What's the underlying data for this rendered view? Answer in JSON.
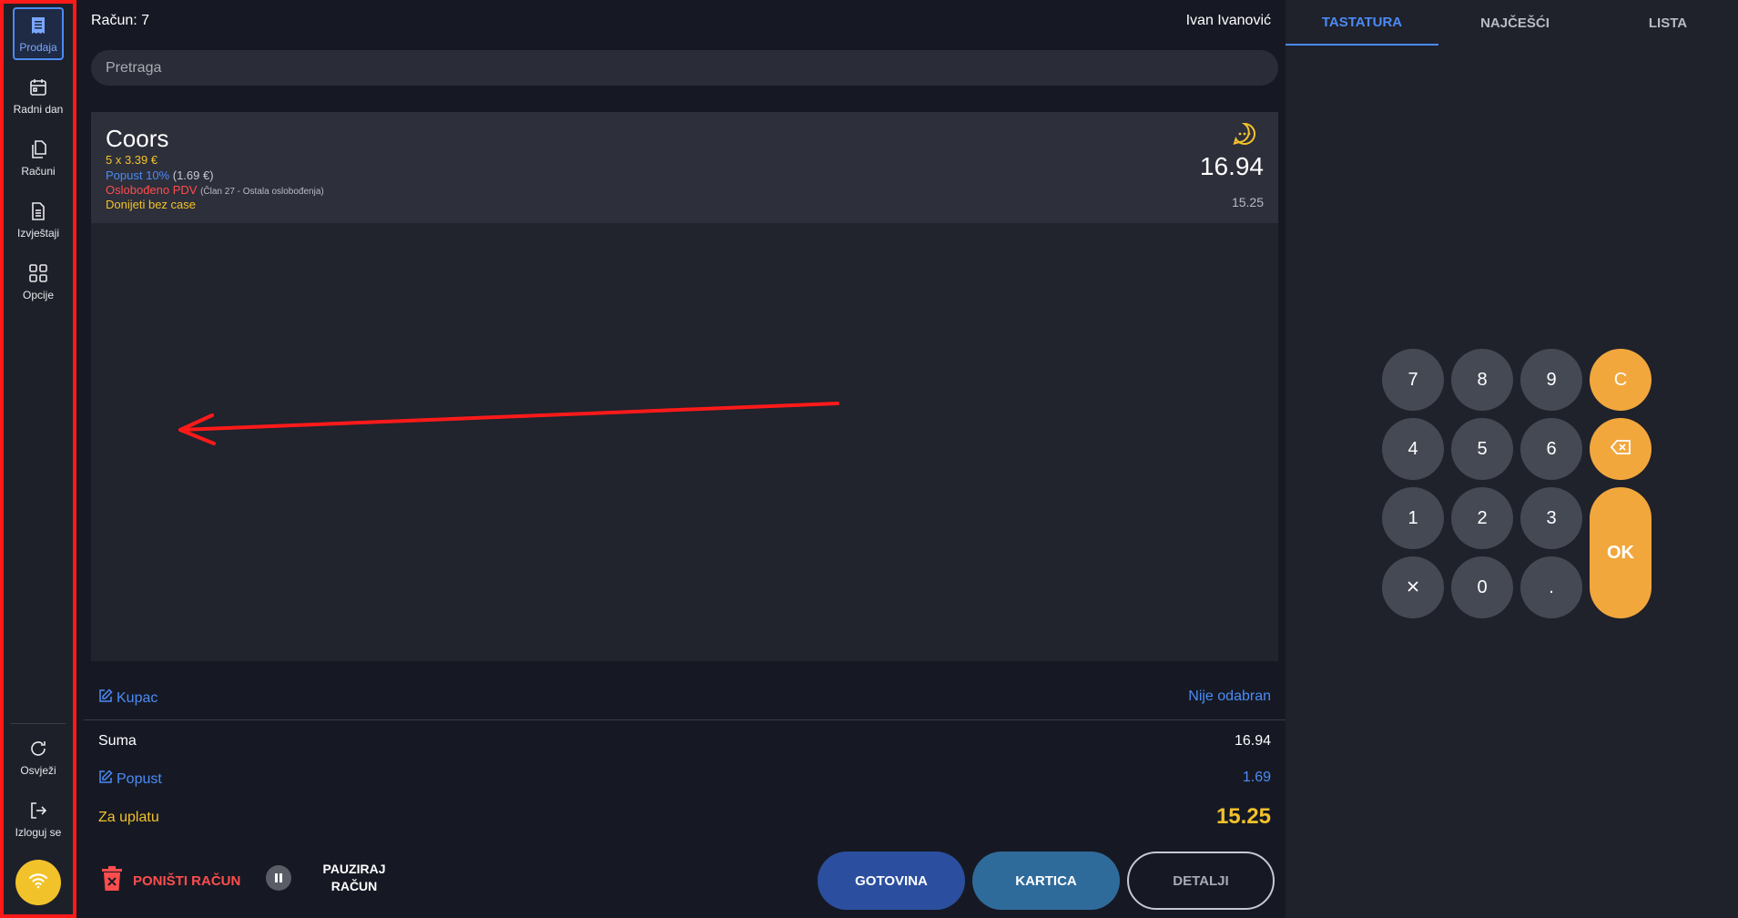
{
  "sidebar": {
    "items": [
      {
        "label": "Prodaja"
      },
      {
        "label": "Radni dan"
      },
      {
        "label": "Računi"
      },
      {
        "label": "Izvještaji"
      },
      {
        "label": "Opcije"
      }
    ],
    "bottom": [
      {
        "label": "Osvježi"
      },
      {
        "label": "Izloguj se"
      }
    ]
  },
  "header": {
    "racun": "Račun: 7",
    "user": "Ivan Ivanović"
  },
  "search": {
    "placeholder": "Pretraga"
  },
  "item": {
    "name": "Coors",
    "qty_line": "5 x 3.39 €",
    "discount": "Popust 10%",
    "discount_amount": "(1.69 €)",
    "vat": "Oslobođeno PDV",
    "vat_note": "(Član 27 - Ostala oslobođenja)",
    "note": "Donijeti bez case",
    "total": "16.94",
    "after_discount": "15.25"
  },
  "summary": {
    "kupac_label": "Kupac",
    "kupac_value": "Nije odabran",
    "suma_label": "Suma",
    "suma_value": "16.94",
    "popust_label": "Popust",
    "popust_value": "1.69",
    "za_uplatu_label": "Za uplatu",
    "za_uplatu_value": "15.25"
  },
  "actions": {
    "cancel": "PONIŠTI RAČUN",
    "pause_line1": "PAUZIRAJ",
    "pause_line2": "RAČUN",
    "cash": "GOTOVINA",
    "card": "KARTICA",
    "details": "DETALJI"
  },
  "tabs": [
    "TASTATURA",
    "NAJČEŠĆI",
    "LISTA"
  ],
  "keypad": {
    "row1": [
      "7",
      "8",
      "9",
      "C"
    ],
    "row2": [
      "4",
      "5",
      "6"
    ],
    "row3": [
      "1",
      "2",
      "3"
    ],
    "row4": [
      "0",
      "."
    ],
    "ok": "OK"
  },
  "colors": {
    "accent_blue": "#4b8bf5",
    "accent_orange": "#f2a73d",
    "accent_yellow": "#f2c22b",
    "danger": "#ff4d4d",
    "cash_button": "#2b4f9e",
    "card_button": "#2f6b9a",
    "highlight_border": "#ff1a1a"
  },
  "icons": [
    "receipt-icon",
    "calendar-icon",
    "documents-icon",
    "report-icon",
    "grid-icon",
    "refresh-icon",
    "logout-icon",
    "wifi-icon",
    "chat-icon",
    "edit-icon",
    "trash-icon",
    "pause-icon",
    "backspace-icon",
    "close-icon"
  ]
}
